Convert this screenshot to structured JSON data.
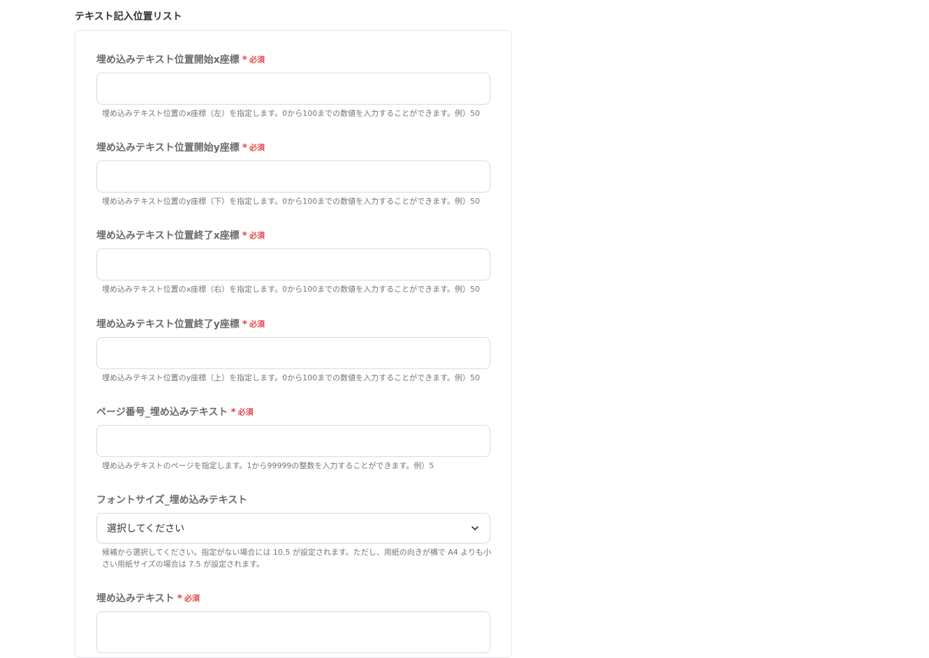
{
  "section": {
    "title": "テキスト記入位置リスト"
  },
  "required_label": "必須",
  "required_mark": "*",
  "fields": [
    {
      "label": "埋め込みテキスト位置開始x座標",
      "value": "",
      "help": "埋め込みテキスト位置のx座標（左）を指定します。0から100までの数値を入力することができます。例）50"
    },
    {
      "label": "埋め込みテキスト位置開始y座標",
      "value": "",
      "help": "埋め込みテキスト位置のy座標（下）を指定します。0から100までの数値を入力することができます。例）50"
    },
    {
      "label": "埋め込みテキスト位置終了x座標",
      "value": "",
      "help": "埋め込みテキスト位置のx座標（右）を指定します。0から100までの数値を入力することができます。例）50"
    },
    {
      "label": "埋め込みテキスト位置終了y座標",
      "value": "",
      "help": "埋め込みテキスト位置のy座標（上）を指定します。0から100までの数値を入力することができます。例）50"
    },
    {
      "label": "ページ番号_埋め込みテキスト",
      "value": "",
      "help": "埋め込みテキストのページを指定します。1から99999の整数を入力することができます。例）5"
    }
  ],
  "font_size": {
    "label": "フォントサイズ_埋め込みテキスト",
    "selected": "選択してください",
    "help": "候補から選択してください。指定がない場合には 10.5 が設定されます。ただし、用紙の向きが横で A4 よりも小さい用紙サイズの場合は 7.5 が設定されます。"
  },
  "text_field": {
    "label": "埋め込みテキスト",
    "value": ""
  },
  "colors": {
    "required": "#e5484d",
    "border": "#d7dadf"
  }
}
